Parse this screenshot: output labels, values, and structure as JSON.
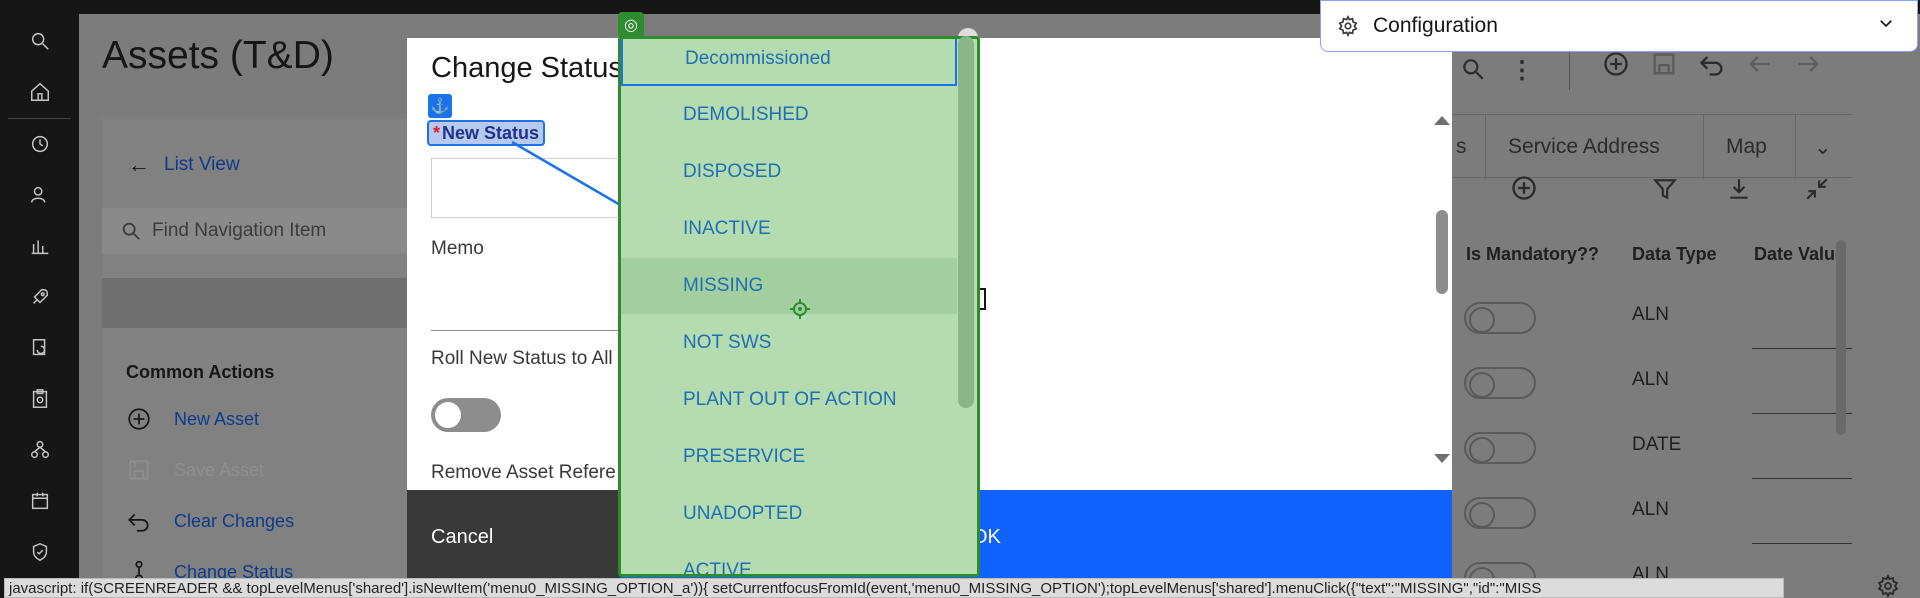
{
  "page": {
    "title": "Assets (T&D)"
  },
  "left_panel": {
    "list_view": "List View",
    "find_placeholder": "Find Navigation Item",
    "common_actions_title": "Common Actions",
    "actions": [
      {
        "label": "New Asset",
        "icon": "add-circle-icon",
        "enabled": true
      },
      {
        "label": "Save Asset",
        "icon": "save-icon",
        "enabled": false
      },
      {
        "label": "Clear Changes",
        "icon": "undo-icon",
        "enabled": true
      },
      {
        "label": "Change Status",
        "icon": "status-icon",
        "enabled": true
      }
    ]
  },
  "modal": {
    "title": "Change Status",
    "new_status_label": "New Status",
    "required_mark": "*",
    "memo_label": "Memo",
    "roll_label": "Roll New Status to All",
    "remove_label": "Remove Asset Refere",
    "cancel_label": "Cancel",
    "ok_label": "OK"
  },
  "dropdown": {
    "options": [
      "Decommissioned",
      "DEMOLISHED",
      "DISPOSED",
      "INACTIVE",
      "MISSING",
      "NOT SWS",
      "PLANT OUT OF ACTION",
      "PRESERVICE",
      "UNADOPTED",
      "ACTIVE"
    ],
    "hovered": "MISSING"
  },
  "right_panel": {
    "tabs": [
      "s",
      "Service Address",
      "Map"
    ],
    "columns": [
      "Is Mandatory??",
      "Data Type",
      "Date Value"
    ],
    "rows": [
      {
        "data_type": "ALN"
      },
      {
        "data_type": "ALN"
      },
      {
        "data_type": "DATE"
      },
      {
        "data_type": "ALN"
      },
      {
        "data_type": "ALN"
      }
    ]
  },
  "config_panel": {
    "title": "Configuration"
  },
  "status_bar": {
    "text": "javascript: if(SCREENREADER && topLevelMenus['shared'].isNewItem('menu0_MISSING_OPTION_a')){ setCurrentfocusFromId(event,'menu0_MISSING_OPTION');topLevelMenus['shared'].menuClick({\"text\":\"MISSING\",\"id\":\"MISS"
  },
  "colors": {
    "dropdown_bg": "#b5dcb0",
    "dropdown_border": "#2e8b2e",
    "link_blue": "#1f6fb2",
    "primary_button": "#0f62fe",
    "secondary_button": "#393939"
  }
}
